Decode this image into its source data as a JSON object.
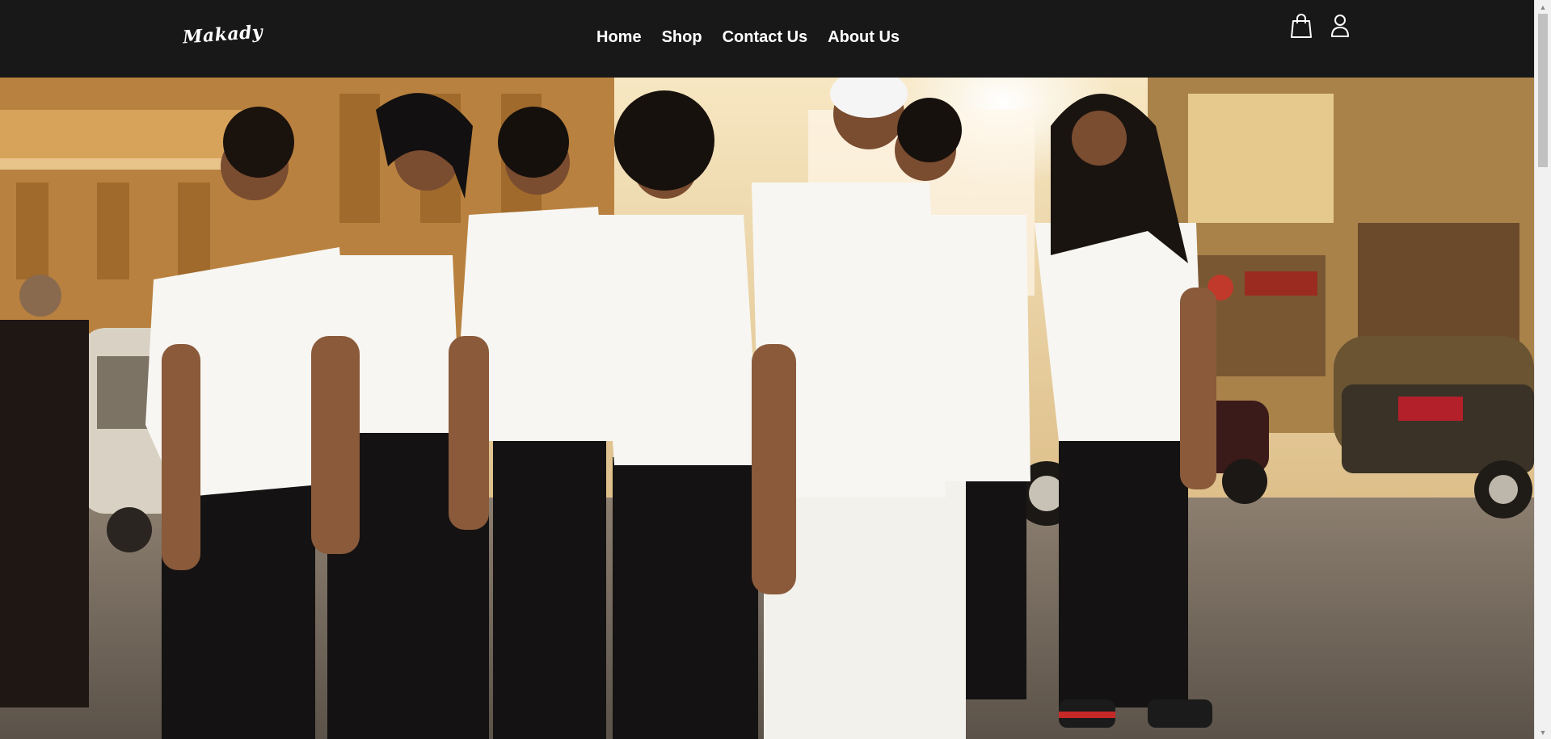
{
  "brand": {
    "logo_text": "Makady"
  },
  "nav": {
    "items": [
      {
        "label": "Home"
      },
      {
        "label": "Shop"
      },
      {
        "label": "Contact Us"
      },
      {
        "label": "About Us"
      }
    ]
  },
  "header_icons": {
    "cart": "shopping-bag-icon",
    "account": "user-icon"
  },
  "hero": {
    "image_alt": "",
    "colors": {
      "header_bg": "#181818",
      "nav_text": "#ffffff"
    }
  }
}
